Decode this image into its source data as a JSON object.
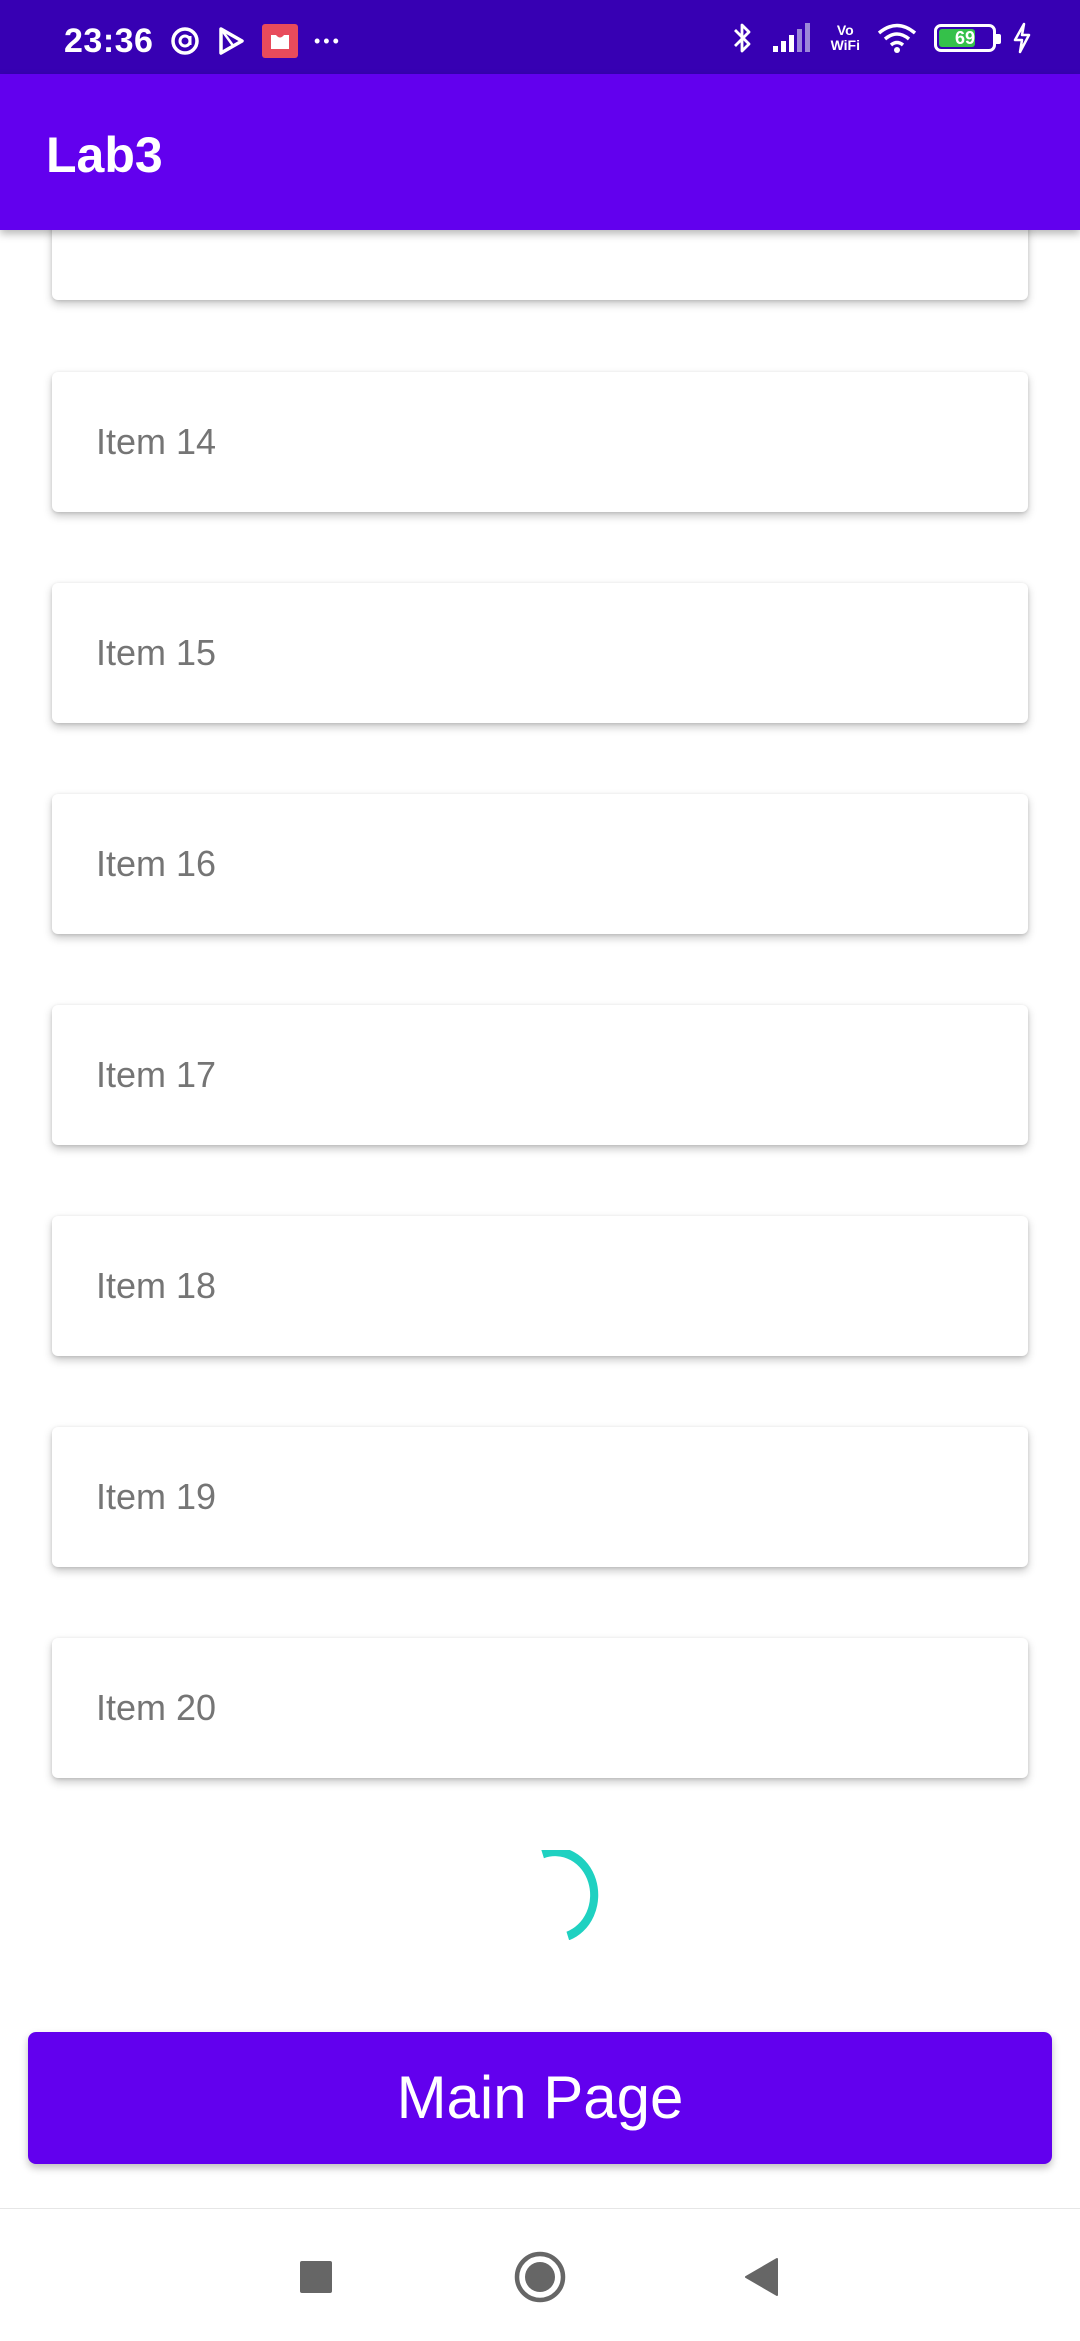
{
  "status_bar": {
    "time": "23:36",
    "battery_level": "69",
    "battery_fraction": 0.69,
    "vowifi_top": "Vo",
    "vowifi_bottom": "WiFi",
    "overflow_dots": "•••",
    "icons": [
      "at-sign-icon",
      "play-store-icon",
      "app-notification-icon",
      "more-dots-icon",
      "bluetooth-icon",
      "signal-icon",
      "vowifi-icon",
      "wifi-icon",
      "battery-icon",
      "charging-icon"
    ],
    "colors": {
      "background": "#3700b3",
      "battery_fill": "#35c14a",
      "notification_badge": "#e84b5b"
    }
  },
  "app_bar": {
    "title": "Lab3",
    "color": "#6200ee"
  },
  "list": {
    "items": [
      {
        "label": ""
      },
      {
        "label": "Item 14"
      },
      {
        "label": "Item 15"
      },
      {
        "label": "Item 16"
      },
      {
        "label": "Item 17"
      },
      {
        "label": "Item 18"
      },
      {
        "label": "Item 19"
      },
      {
        "label": "Item 20"
      }
    ],
    "loading_indicator": {
      "color": "#1fd1c1"
    }
  },
  "main_button": {
    "label": "Main Page",
    "color": "#6200ee"
  },
  "nav_bar": {
    "buttons": [
      "recents-square-icon",
      "home-circle-icon",
      "back-triangle-icon"
    ]
  }
}
